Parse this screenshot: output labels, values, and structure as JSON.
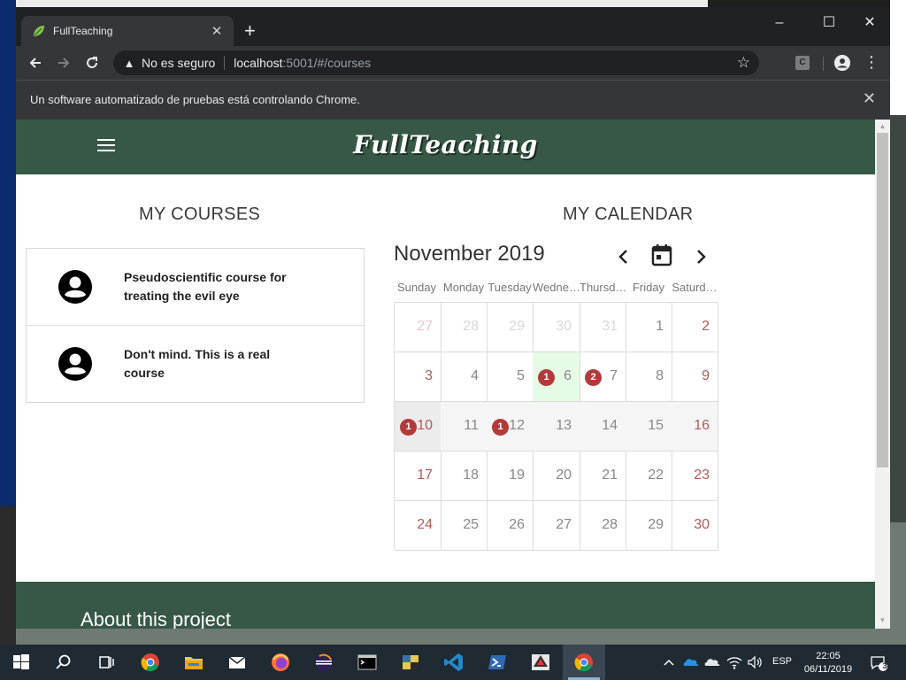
{
  "browser": {
    "tab_title": "FullTeaching",
    "new_tab": "+",
    "window_controls": {
      "minimize": "–",
      "maximize": "☐",
      "close": "✕"
    },
    "security_label": "No es seguro",
    "url_host": "localhost",
    "url_rest": ":5001/#/courses",
    "extension_label": "C",
    "infobar_text": "Un software automatizado de pruebas está controlando Chrome."
  },
  "app": {
    "brand": "FullTeaching",
    "courses_title": "MY COURSES",
    "calendar_title": "MY CALENDAR",
    "courses": [
      {
        "name": "Pseudoscientific course for treating the evil eye"
      },
      {
        "name": "Don't mind. This is a real course"
      }
    ],
    "footer_title": "About this project"
  },
  "calendar": {
    "month_label": "November 2019",
    "day_headers": [
      "Sunday",
      "Monday",
      "Tuesday",
      "Wedne…",
      "Thursd…",
      "Friday",
      "Saturd…"
    ],
    "weeks": [
      [
        {
          "d": "27",
          "o": true
        },
        {
          "d": "28",
          "o": true
        },
        {
          "d": "29",
          "o": true
        },
        {
          "d": "30",
          "o": true
        },
        {
          "d": "31",
          "o": true
        },
        {
          "d": "1"
        },
        {
          "d": "2"
        }
      ],
      [
        {
          "d": "3"
        },
        {
          "d": "4"
        },
        {
          "d": "5"
        },
        {
          "d": "6",
          "badge": "1",
          "today": true
        },
        {
          "d": "7",
          "badge": "2"
        },
        {
          "d": "8"
        },
        {
          "d": "9"
        }
      ],
      [
        {
          "d": "10",
          "badge": "1",
          "selected": true
        },
        {
          "d": "11",
          "shaded": true
        },
        {
          "d": "12",
          "badge": "1",
          "shaded": true
        },
        {
          "d": "13",
          "shaded": true
        },
        {
          "d": "14",
          "shaded": true
        },
        {
          "d": "15",
          "shaded": true
        },
        {
          "d": "16",
          "shaded": true
        }
      ],
      [
        {
          "d": "17"
        },
        {
          "d": "18"
        },
        {
          "d": "19"
        },
        {
          "d": "20"
        },
        {
          "d": "21"
        },
        {
          "d": "22"
        },
        {
          "d": "23"
        }
      ],
      [
        {
          "d": "24"
        },
        {
          "d": "25"
        },
        {
          "d": "26"
        },
        {
          "d": "27"
        },
        {
          "d": "28"
        },
        {
          "d": "29"
        },
        {
          "d": "30"
        }
      ]
    ]
  },
  "taskbar": {
    "language": "ESP",
    "time": "22:05",
    "date": "06/11/2019",
    "notification_count": "3"
  },
  "colors": {
    "header_green": "#375846",
    "badge_red": "#b33a3a",
    "today_green": "#e6fbe6"
  },
  "icons": [
    "start-icon",
    "search-icon",
    "task-view-icon",
    "chrome-icon",
    "file-explorer-icon",
    "mail-icon",
    "firefox-icon",
    "eclipse-icon",
    "terminal-icon",
    "python-icon",
    "vscode-icon",
    "powershell-icon",
    "inkscape-icon",
    "chrome-active-icon",
    "tray-chevron-icon",
    "onedrive-icon",
    "cloud-icon",
    "wifi-icon",
    "volume-icon",
    "notification-icon"
  ]
}
